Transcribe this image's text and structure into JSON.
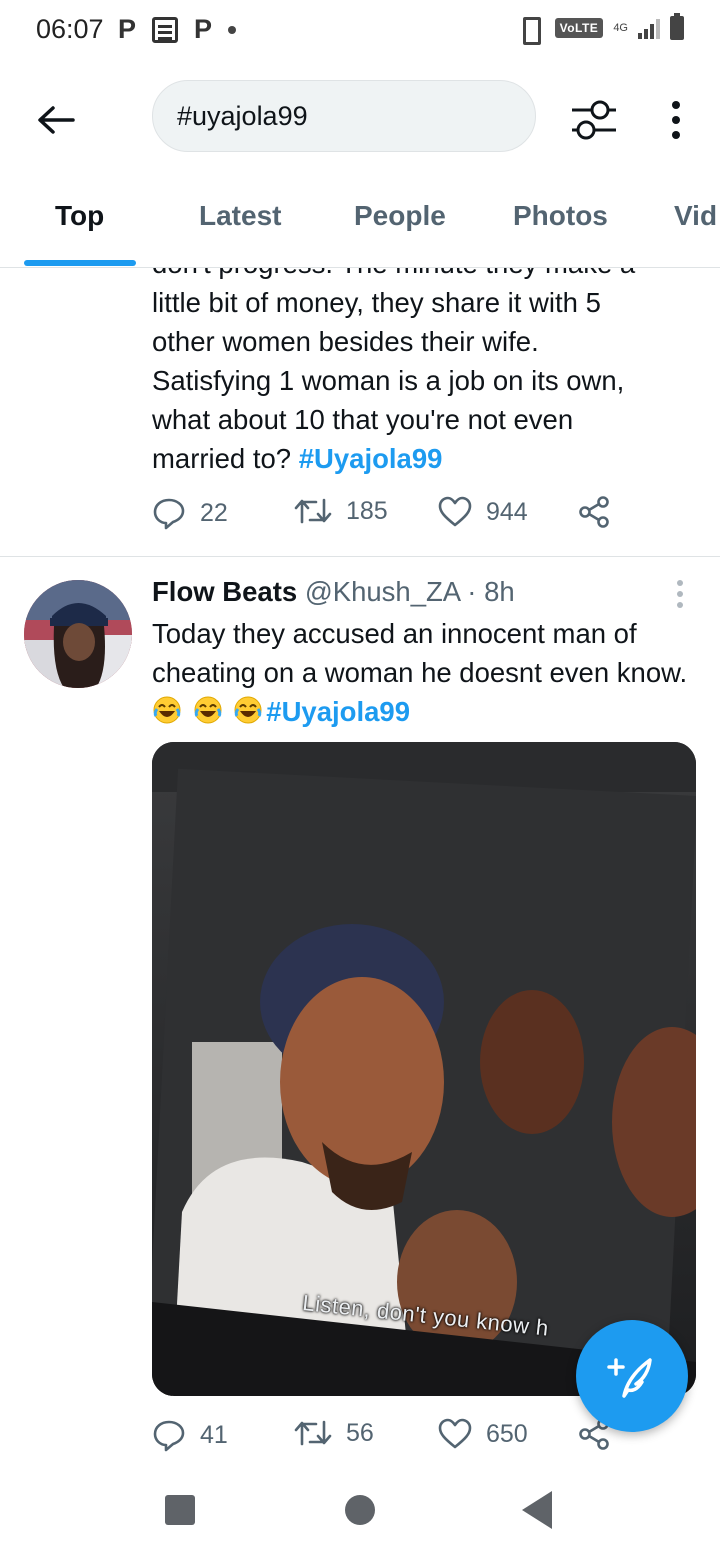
{
  "status_bar": {
    "time": "06:07",
    "left_icons": [
      "P",
      "document-icon",
      "P",
      "dot"
    ],
    "volte": "VoLTE",
    "network": "4G"
  },
  "header": {
    "search_value": "#uyajola99"
  },
  "tabs": [
    {
      "label": "Top",
      "active": true
    },
    {
      "label": "Latest",
      "active": false
    },
    {
      "label": "People",
      "active": false
    },
    {
      "label": "Photos",
      "active": false
    },
    {
      "label": "Vid",
      "active": false
    }
  ],
  "tweet1": {
    "text_lines": [
      "don't progress. The minute they make a",
      "little bit of money, they share it with 5",
      "other women besides their wife.",
      "Satisfying 1 woman is a job on its own,",
      "what about 10 that you're not even",
      "married to?"
    ],
    "hashtag": "#Uyajola99",
    "replies": "22",
    "retweets": "185",
    "likes": "944"
  },
  "tweet2": {
    "name": "Flow Beats",
    "handle": "@Khush_ZA",
    "separator": "·",
    "time": "8h",
    "text": "Today they accused an innocent man of cheating on a woman he doesnt even know.",
    "emoji": "😂😂😂",
    "hashtag": "#Uyajola99",
    "media_caption": "Listen, don't you know h",
    "replies": "41",
    "retweets": "56",
    "likes": "650"
  },
  "colors": {
    "accent": "#1d9bf0",
    "text": "#0f1419",
    "secondary": "#536471",
    "divider": "#dfe3e5"
  }
}
